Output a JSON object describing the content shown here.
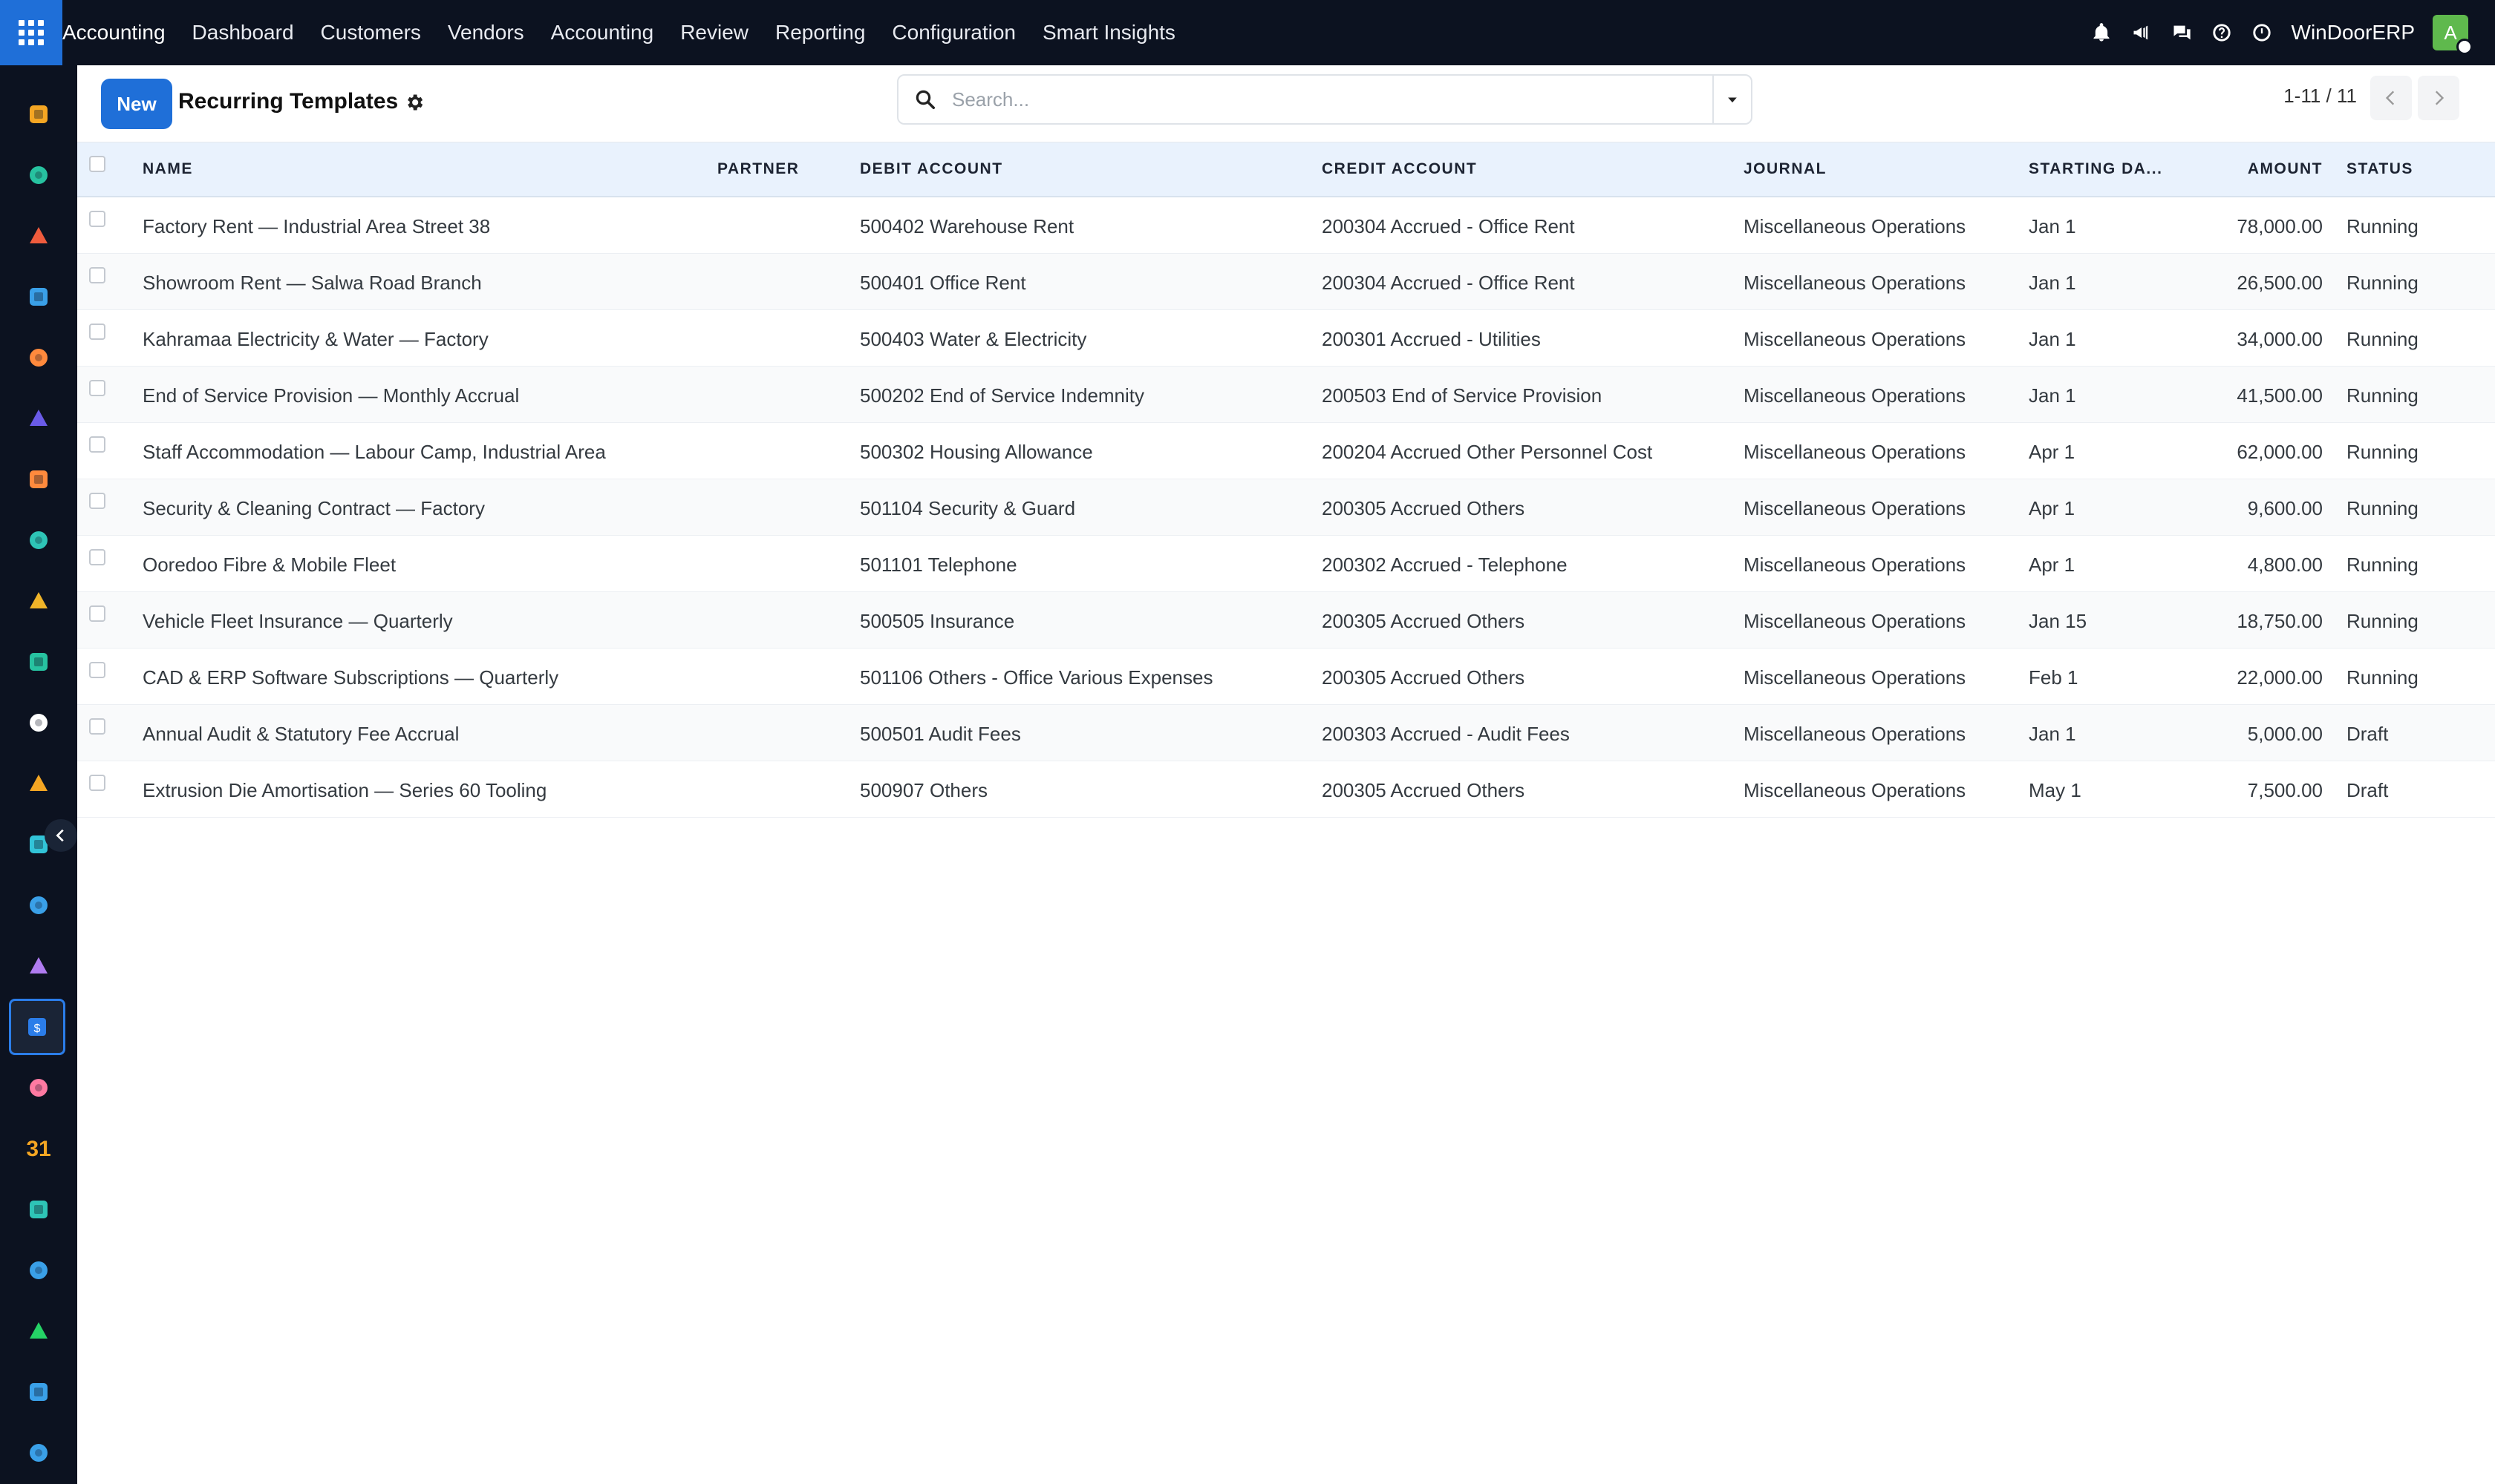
{
  "nav": {
    "brand": "Accounting",
    "menu": [
      "Dashboard",
      "Customers",
      "Vendors",
      "Accounting",
      "Review",
      "Reporting",
      "Configuration",
      "Smart Insights"
    ],
    "company": "WinDoorERP",
    "avatar_letter": "A"
  },
  "control": {
    "new_label": "New",
    "title": "Recurring Templates",
    "search_placeholder": "Search...",
    "pager": "1-11 / 11"
  },
  "sidebar_icons": [
    "app-icon-1",
    "contacts-icon",
    "chart-icon",
    "pie-icon",
    "chat-icon",
    "mail-icon",
    "chat-icon",
    "vendor-icon",
    "bar-icon",
    "contacts-icon",
    "box-icon",
    "app-icon-2",
    "check-icon",
    "book-icon",
    "inventory-icon",
    "accounting-icon",
    "team-icon",
    "calendar-icon",
    "sign-icon",
    "dashboard-icon",
    "whatsapp-icon",
    "clock-icon",
    "sync-icon"
  ],
  "table": {
    "headers": {
      "name": "Name",
      "partner": "Partner",
      "debit": "Debit Account",
      "credit": "Credit Account",
      "journal": "Journal",
      "start": "Starting Da...",
      "amount": "Amount",
      "status": "Status"
    },
    "rows": [
      {
        "name": "Factory Rent — Industrial Area Street 38",
        "partner": "",
        "debit": "500402 Warehouse Rent",
        "credit": "200304 Accrued - Office Rent",
        "journal": "Miscellaneous Operations",
        "start": "Jan 1",
        "amount": "78,000.00",
        "status": "Running"
      },
      {
        "name": "Showroom Rent — Salwa Road Branch",
        "partner": "",
        "debit": "500401 Office Rent",
        "credit": "200304 Accrued - Office Rent",
        "journal": "Miscellaneous Operations",
        "start": "Jan 1",
        "amount": "26,500.00",
        "status": "Running"
      },
      {
        "name": "Kahramaa Electricity & Water — Factory",
        "partner": "",
        "debit": "500403 Water & Electricity",
        "credit": "200301 Accrued - Utilities",
        "journal": "Miscellaneous Operations",
        "start": "Jan 1",
        "amount": "34,000.00",
        "status": "Running"
      },
      {
        "name": "End of Service Provision — Monthly Accrual",
        "partner": "",
        "debit": "500202 End of Service Indemnity",
        "credit": "200503 End of Service Provision",
        "journal": "Miscellaneous Operations",
        "start": "Jan 1",
        "amount": "41,500.00",
        "status": "Running"
      },
      {
        "name": "Staff Accommodation — Labour Camp, Industrial Area",
        "partner": "",
        "debit": "500302 Housing Allowance",
        "credit": "200204 Accrued Other Personnel Cost",
        "journal": "Miscellaneous Operations",
        "start": "Apr 1",
        "amount": "62,000.00",
        "status": "Running"
      },
      {
        "name": "Security & Cleaning Contract — Factory",
        "partner": "",
        "debit": "501104 Security & Guard",
        "credit": "200305 Accrued Others",
        "journal": "Miscellaneous Operations",
        "start": "Apr 1",
        "amount": "9,600.00",
        "status": "Running"
      },
      {
        "name": "Ooredoo Fibre & Mobile Fleet",
        "partner": "",
        "debit": "501101 Telephone",
        "credit": "200302 Accrued - Telephone",
        "journal": "Miscellaneous Operations",
        "start": "Apr 1",
        "amount": "4,800.00",
        "status": "Running"
      },
      {
        "name": "Vehicle Fleet Insurance — Quarterly",
        "partner": "",
        "debit": "500505 Insurance",
        "credit": "200305 Accrued Others",
        "journal": "Miscellaneous Operations",
        "start": "Jan 15",
        "amount": "18,750.00",
        "status": "Running"
      },
      {
        "name": "CAD & ERP Software Subscriptions — Quarterly",
        "partner": "",
        "debit": "501106 Others - Office Various Expenses",
        "credit": "200305 Accrued Others",
        "journal": "Miscellaneous Operations",
        "start": "Feb 1",
        "amount": "22,000.00",
        "status": "Running"
      },
      {
        "name": "Annual Audit & Statutory Fee Accrual",
        "partner": "",
        "debit": "500501 Audit Fees",
        "credit": "200303 Accrued - Audit Fees",
        "journal": "Miscellaneous Operations",
        "start": "Jan 1",
        "amount": "5,000.00",
        "status": "Draft"
      },
      {
        "name": "Extrusion Die Amortisation — Series 60 Tooling",
        "partner": "",
        "debit": "500907 Others",
        "credit": "200305 Accrued Others",
        "journal": "Miscellaneous Operations",
        "start": "May 1",
        "amount": "7,500.00",
        "status": "Draft"
      }
    ]
  }
}
